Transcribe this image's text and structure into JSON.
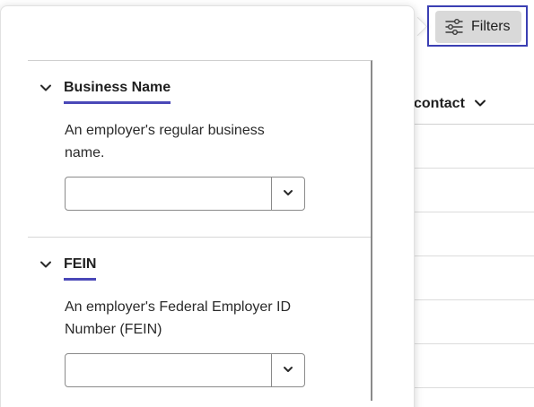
{
  "toolbar": {
    "filters_label": "Filters",
    "filters_icon": "sliders-icon"
  },
  "table": {
    "column_header": "contact",
    "row_count": 6
  },
  "filters_panel": {
    "sections": [
      {
        "title": "Business Name",
        "description": "An employer's regular business name.",
        "input_value": "",
        "expanded": true
      },
      {
        "title": "FEIN",
        "description": "An employer's Federal Employer ID Number (FEIN)",
        "input_value": "",
        "expanded": true
      }
    ]
  },
  "colors": {
    "accent": "#3b3fb3",
    "underline": "#4a48b8",
    "button_bg": "#d9d9d9"
  }
}
